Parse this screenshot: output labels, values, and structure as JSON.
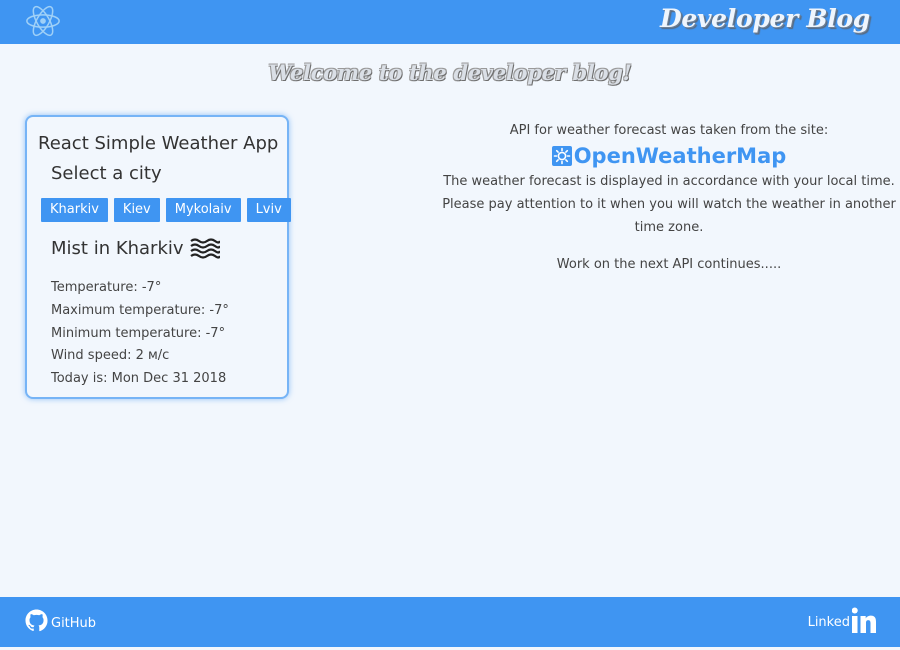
{
  "header": {
    "brand": "Developer Blog",
    "logo_icon": "react-atom-icon"
  },
  "welcome": "Welcome to the developer blog!",
  "weather_app": {
    "title": "React Simple Weather App",
    "select_label": "Select a city",
    "cities": [
      "Kharkiv",
      "Kiev",
      "Mykolaiv",
      "Lviv"
    ],
    "condition": "Mist in Kharkiv",
    "condition_icon": "mist-icon",
    "temperature": "Temperature: -7°",
    "max_temperature": "Maximum temperature: -7°",
    "min_temperature": "Minimum temperature: -7°",
    "wind_speed": "Wind speed: 2 м/с",
    "today": "Today is: Mon Dec 31 2018"
  },
  "info": {
    "api_source": "API for weather forecast was taken from the site:",
    "owm_link": "OpenWeatherMap",
    "owm_icon": "sun-icon",
    "local_time_1": "The weather forecast is displayed in accordance with your local time.",
    "local_time_2": "Please pay attention to it when you will watch the weather in another",
    "local_time_3": "time zone.",
    "next_api": "Work on the next API continues....."
  },
  "footer": {
    "github_label": "GitHub",
    "github_icon": "github-icon",
    "linkedin_label": "Linked",
    "linkedin_icon": "linkedin-in-icon"
  },
  "colors": {
    "accent": "#3f95f2",
    "background": "#f2f7fd",
    "card_border": "#76b4f6"
  }
}
